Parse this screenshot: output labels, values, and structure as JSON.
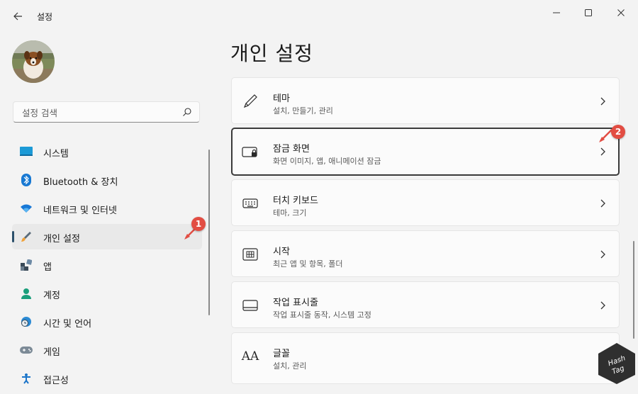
{
  "window": {
    "title": "설정",
    "controls": [
      "minimize-icon",
      "maximize-icon",
      "close-icon"
    ]
  },
  "search": {
    "placeholder": "설정 검색"
  },
  "sidebar": {
    "items": [
      {
        "label": "시스템",
        "icon": "system-icon",
        "selected": false
      },
      {
        "label": "Bluetooth & 장치",
        "icon": "bluetooth-icon",
        "selected": false
      },
      {
        "label": "네트워크 및 인터넷",
        "icon": "wifi-icon",
        "selected": false
      },
      {
        "label": "개인 설정",
        "icon": "brush-icon",
        "selected": true
      },
      {
        "label": "앱",
        "icon": "apps-icon",
        "selected": false
      },
      {
        "label": "계정",
        "icon": "account-icon",
        "selected": false
      },
      {
        "label": "시간 및 언어",
        "icon": "time-language-icon",
        "selected": false
      },
      {
        "label": "게임",
        "icon": "gaming-icon",
        "selected": false
      },
      {
        "label": "접근성",
        "icon": "accessibility-icon",
        "selected": false
      }
    ]
  },
  "main": {
    "title": "개인 설정",
    "cards": [
      {
        "title": "테마",
        "subtitle": "설치, 만들기, 관리",
        "icon": "pen-icon"
      },
      {
        "title": "잠금 화면",
        "subtitle": "화면 이미지, 앱, 애니메이션 잠금",
        "icon": "lock-screen-icon"
      },
      {
        "title": "터치 키보드",
        "subtitle": "테마, 크기",
        "icon": "keyboard-icon"
      },
      {
        "title": "시작",
        "subtitle": "최근 앱 및 항목, 폴더",
        "icon": "start-icon"
      },
      {
        "title": "작업 표시줄",
        "subtitle": "작업 표시줄 동작, 시스템 고정",
        "icon": "taskbar-icon"
      },
      {
        "title": "글꼴",
        "subtitle": "설치, 관리",
        "icon": "font-icon",
        "glyph": "AA"
      }
    ]
  },
  "annotations": {
    "badge1": "1",
    "badge2": "2"
  },
  "watermark": {
    "line1": "Hash",
    "line2": "Tag"
  },
  "colors": {
    "accent": "#0067c0",
    "badge": "#e24d43",
    "selected_bar": "#2b4f6a"
  }
}
